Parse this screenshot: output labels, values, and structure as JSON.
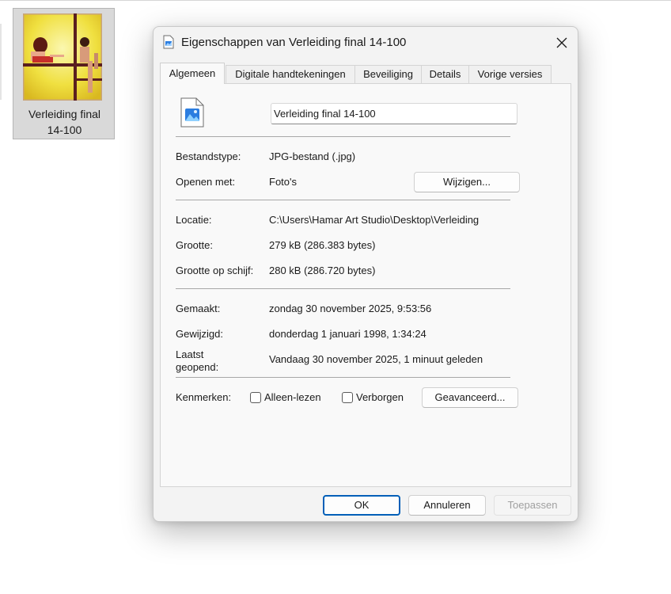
{
  "desktop": {
    "item_label_line1": "Verleiding final",
    "item_label_line2": "14-100"
  },
  "dialog": {
    "title": "Eigenschappen van Verleiding final 14-100",
    "tabs": [
      {
        "label": "Algemeen",
        "active": true
      },
      {
        "label": "Digitale handtekeningen",
        "active": false
      },
      {
        "label": "Beveiliging",
        "active": false
      },
      {
        "label": "Details",
        "active": false
      },
      {
        "label": "Vorige versies",
        "active": false
      }
    ],
    "general": {
      "filename": "Verleiding final 14-100",
      "file_type_label": "Bestandstype:",
      "file_type_value": "JPG-bestand (.jpg)",
      "open_with_label": "Openen met:",
      "open_with_value": "Foto's",
      "change_button": "Wijzigen...",
      "location_label": "Locatie:",
      "location_value": "C:\\Users\\Hamar Art Studio\\Desktop\\Verleiding",
      "size_label": "Grootte:",
      "size_value": "279 kB (286.383 bytes)",
      "size_on_disk_label": "Grootte op schijf:",
      "size_on_disk_value": "280 kB (286.720 bytes)",
      "created_label": "Gemaakt:",
      "created_value": "zondag 30 november 2025, 9:53:56",
      "modified_label": "Gewijzigd:",
      "modified_value": "donderdag 1 januari 1998, 1:34:24",
      "accessed_label_line1": "Laatst",
      "accessed_label_line2": "geopend:",
      "accessed_value": "Vandaag 30 november 2025, 1 minuut geleden",
      "attributes_label": "Kenmerken:",
      "readonly_label": "Alleen-lezen",
      "readonly_checked": false,
      "hidden_label": "Verborgen",
      "hidden_checked": false,
      "advanced_button": "Geavanceerd..."
    },
    "footer": {
      "ok": "OK",
      "cancel": "Annuleren",
      "apply": "Toepassen"
    }
  },
  "colors": {
    "accent": "#005fb8",
    "disabled_text": "#a0a0a0",
    "icon_blue": "#2b7de0"
  },
  "icons": [
    "image-file-icon",
    "close-icon",
    "checkbox-icon"
  ]
}
